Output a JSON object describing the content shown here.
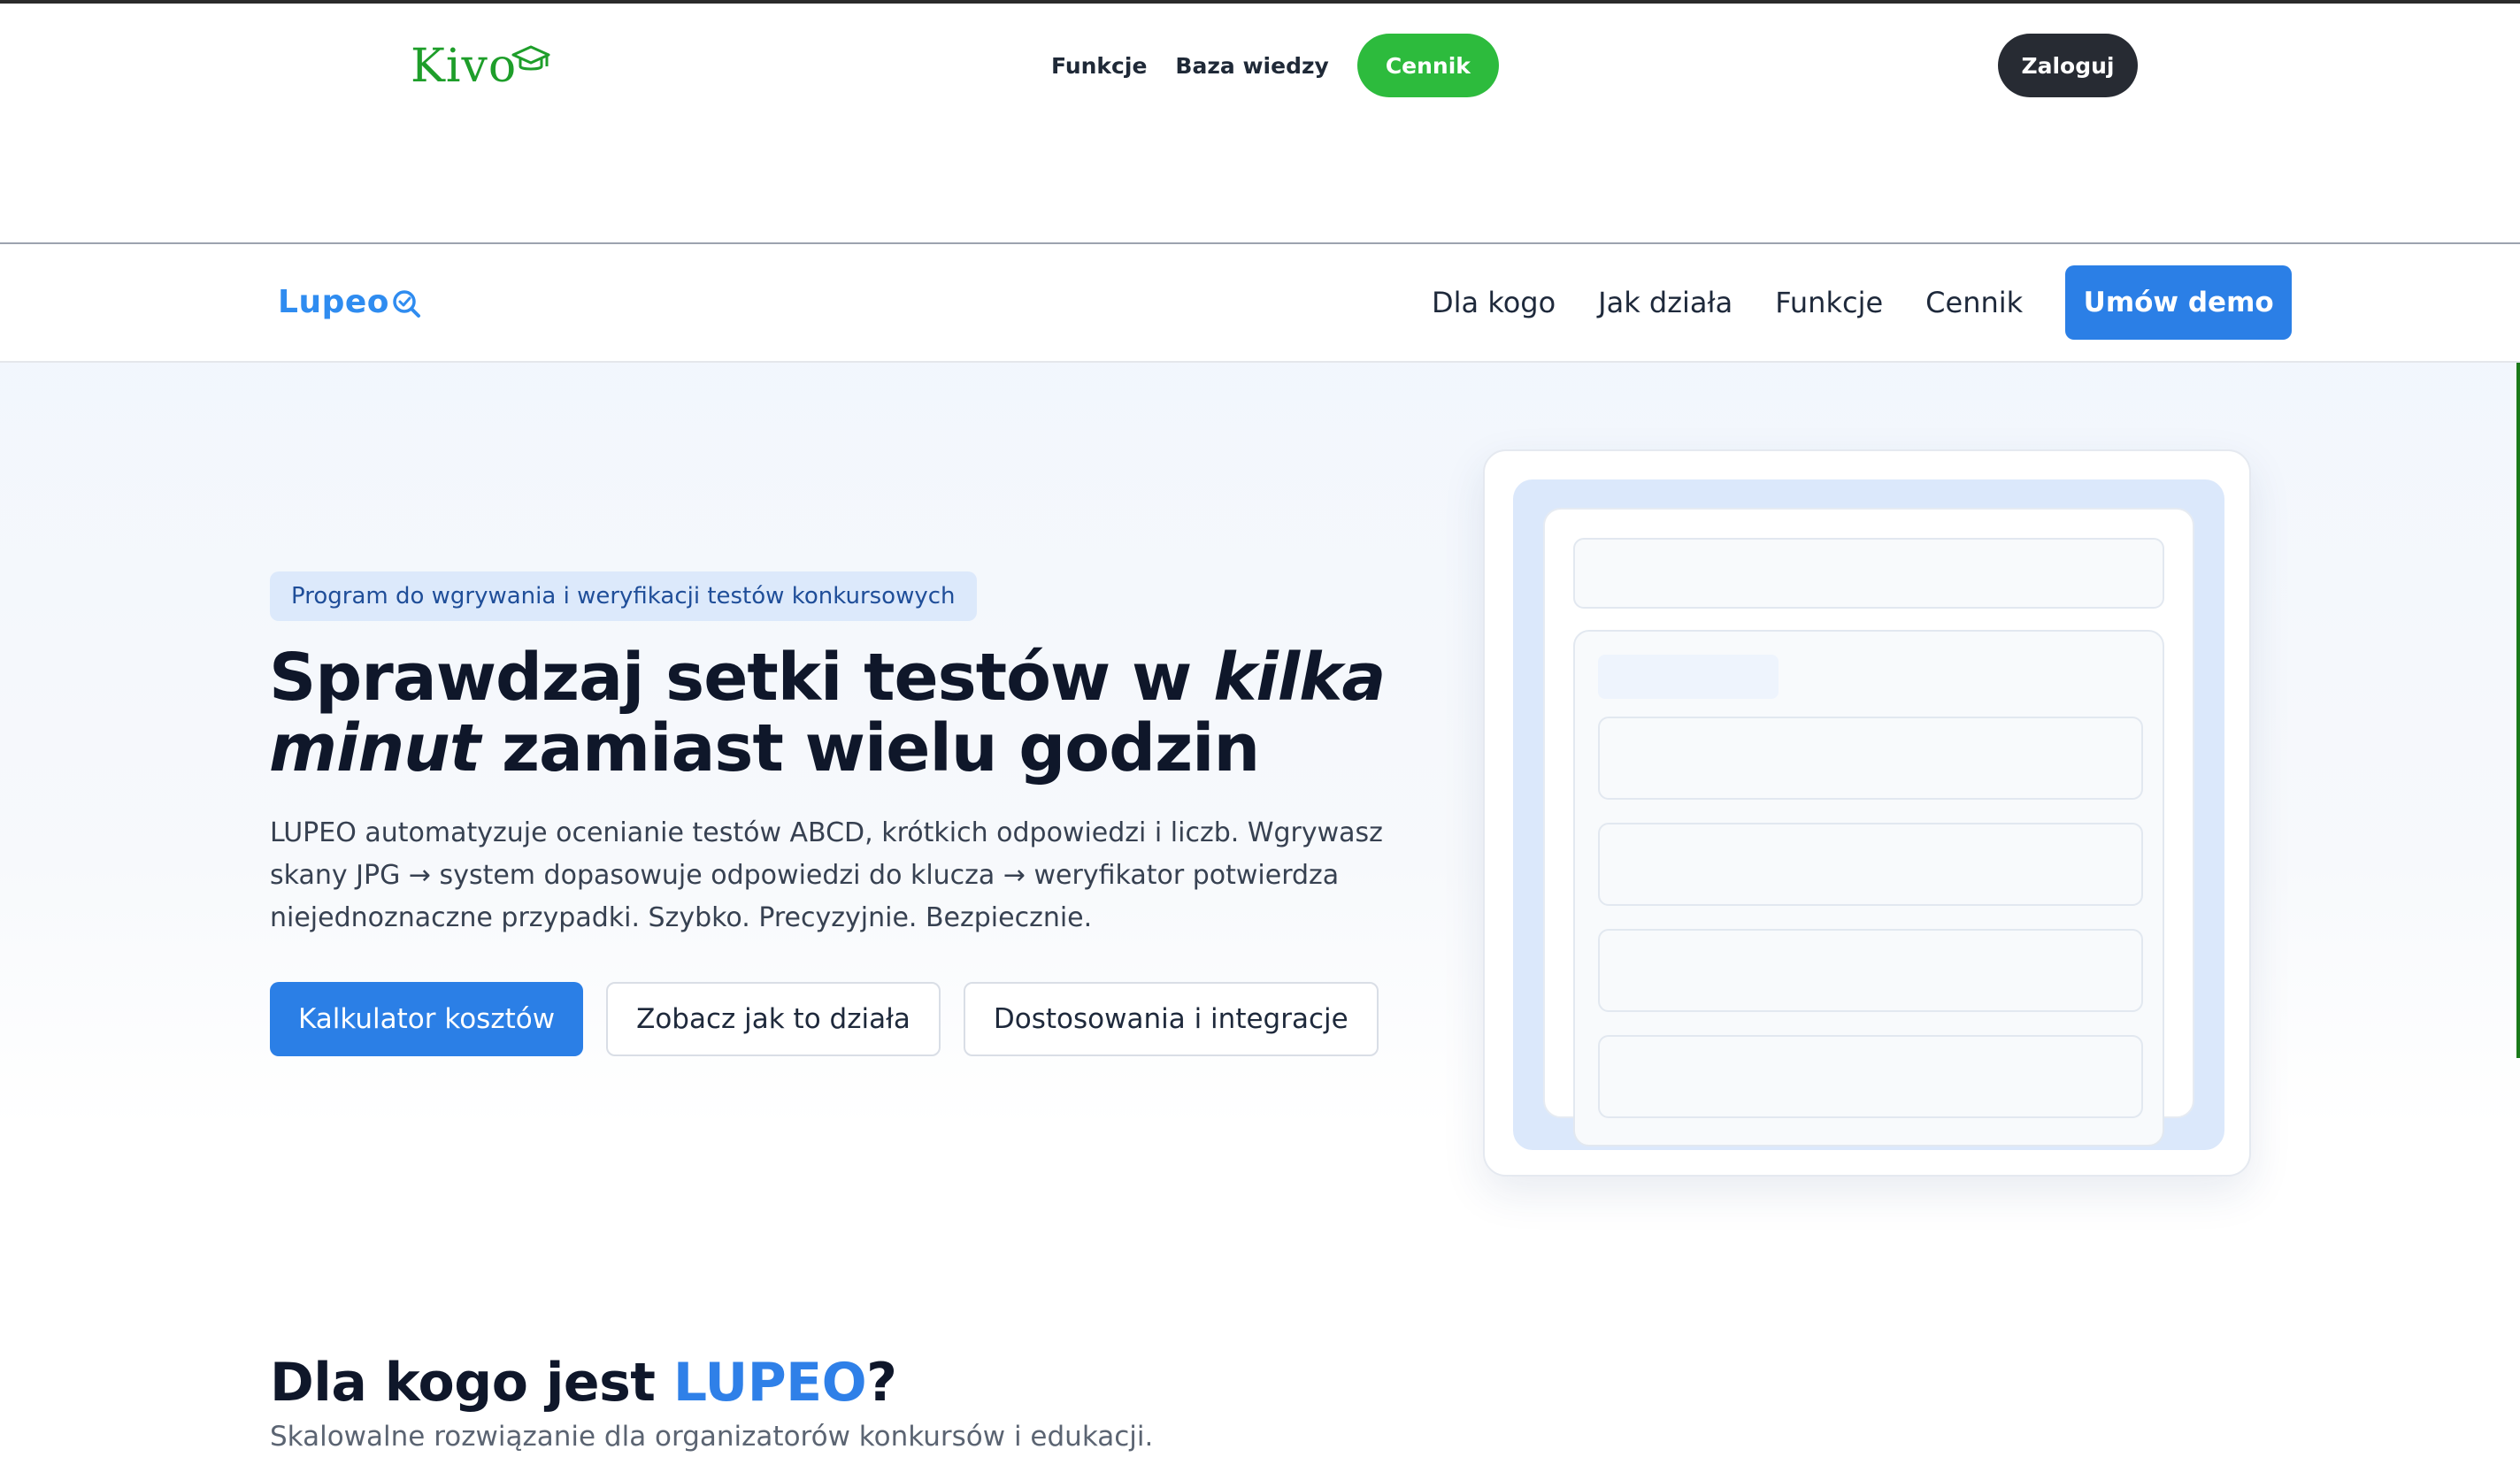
{
  "kivo": {
    "logo": "Kivo",
    "nav": [
      "Funkcje",
      "Baza wiedzy"
    ],
    "pricing_button": "Cennik",
    "login_button": "Zaloguj",
    "brand_color": "#2dbb3d"
  },
  "lupeo": {
    "logo": "Lupeo",
    "nav": [
      "Dla kogo",
      "Jak działa",
      "Funkcje",
      "Cennik"
    ],
    "demo_button": "Umów demo",
    "accent_color": "#2b7fe6",
    "hero": {
      "badge": "Program do wgrywania i weryfikacji testów konkursowych",
      "title_part1": "Sprawdzaj setki testów w ",
      "title_em1": "kilka",
      "title_em2": "minut",
      "title_part2": " zamiast wielu godzin",
      "description": "LUPEO automatyzuje ocenianie testów ABCD, krótkich odpowiedzi i liczb. Wgrywasz skany JPG → system dopasowuje odpowiedzi do klucza → weryfikator potwierdza niejednoznaczne przypadki. Szybko. Precyzyjnie. Bezpiecznie.",
      "buttons": [
        "Kalkulator kosztów",
        "Zobacz jak to działa",
        "Dostosowania i integracje"
      ]
    },
    "section": {
      "title_prefix": "Dla kogo jest ",
      "title_accent": "LUPEO",
      "title_suffix": "?",
      "subtitle": "Skalowalne rozwiązanie dla organizatorów konkursów i edukacji."
    }
  }
}
